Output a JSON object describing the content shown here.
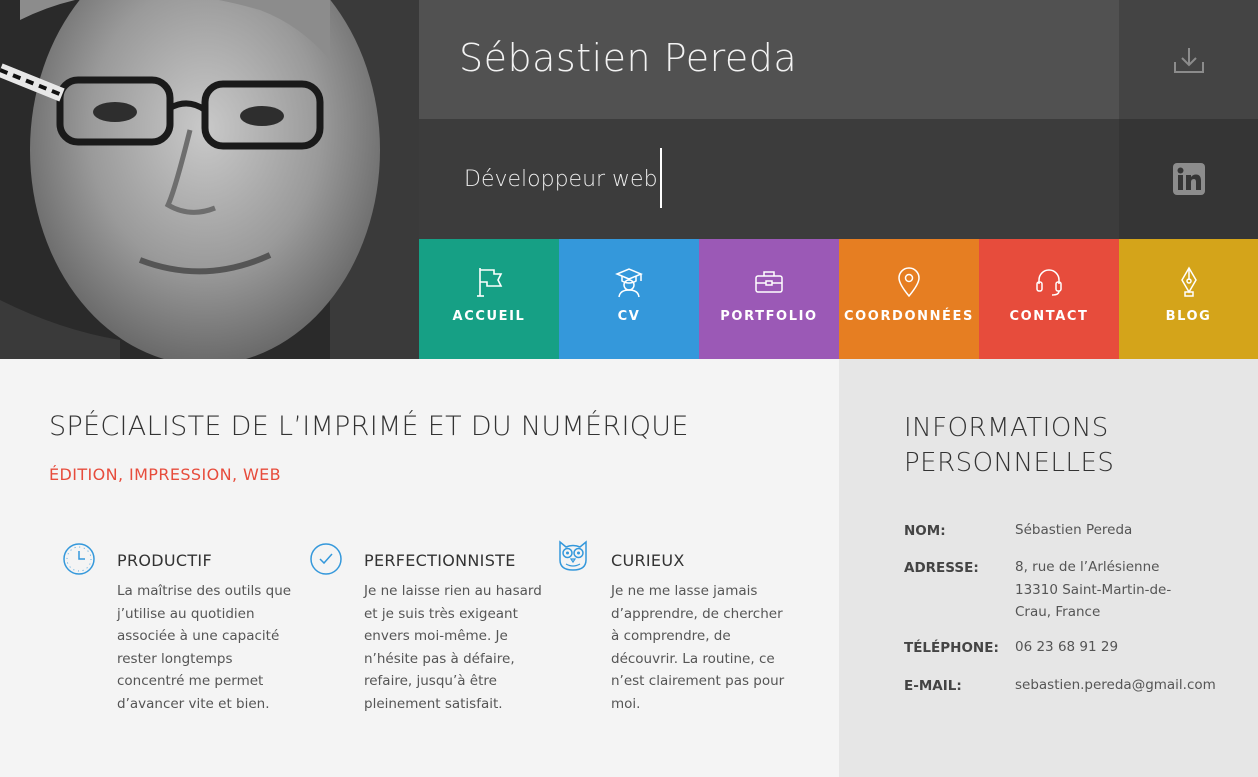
{
  "header": {
    "name": "Sébastien Pereda",
    "role": "Développeur web",
    "download_icon": "download-icon",
    "linkedin_icon": "linkedin-icon",
    "colors": {
      "name_bar": "#515151",
      "role_bar": "#3c3c3c"
    }
  },
  "nav": {
    "items": [
      {
        "label": "ACCUEIL",
        "icon": "flag-icon",
        "color": "#16a085"
      },
      {
        "label": "CV",
        "icon": "graduate-icon",
        "color": "#3498db"
      },
      {
        "label": "PORTFOLIO",
        "icon": "briefcase-icon",
        "color": "#9b59b6"
      },
      {
        "label": "COORDONNÉES",
        "icon": "map-pin-icon",
        "color": "#e67e22"
      },
      {
        "label": "CONTACT",
        "icon": "headset-icon",
        "color": "#e74c3c"
      },
      {
        "label": "BLOG",
        "icon": "pen-nib-icon",
        "color": "#d4a41a"
      }
    ]
  },
  "main": {
    "headline": "SPÉCIALISTE DE L’IMPRIMÉ ET DU NUMÉRIQUE",
    "subline": "ÉDITION, IMPRESSION, WEB",
    "accent_color": "#e74c3c",
    "qualities": [
      {
        "icon": "clock-icon",
        "title": "PRODUCTIF",
        "text": "La maîtrise des outils que j’utilise au quotidien associée à une capacité rester longtemps concentré me permet d’avancer vite et bien."
      },
      {
        "icon": "check-circle-icon",
        "title": "PERFECTIONNISTE",
        "text": "Je ne laisse rien au hasard et je suis très exigeant envers moi-même. Je n’hésite pas à défaire, refaire, jusqu’à être pleinement satisfait."
      },
      {
        "icon": "owl-icon",
        "title": "CURIEUX",
        "text": "Je ne me lasse jamais d’apprendre, de chercher à comprendre, de découvrir. La routine, ce n’est clairement pas pour moi."
      }
    ]
  },
  "sidebar": {
    "title_line1": "INFORMATIONS",
    "title_line2": "PERSONNELLES",
    "rows": [
      {
        "key": "NOM:",
        "value": "Sébastien Pereda"
      },
      {
        "key": "ADRESSE:",
        "value": "8, rue de l’Arlésienne\n13310 Saint-Martin-de-\nCrau, France"
      },
      {
        "key": "TÉLÉPHONE:",
        "value": "06 23 68 91 29"
      },
      {
        "key": "E-MAIL:",
        "value": "sebastien.pereda@gmail.com"
      }
    ]
  }
}
